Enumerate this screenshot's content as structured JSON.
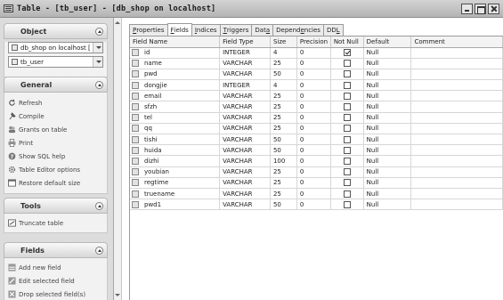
{
  "window": {
    "title": "Table - [tb_user] - [db_shop on localhost]"
  },
  "sidebar": {
    "object_panel": {
      "header": "Object",
      "database_combo": "db_shop on localhost [",
      "table_combo": "tb_user"
    },
    "general_panel": {
      "header": "General",
      "items": [
        {
          "label": "Refresh",
          "icon": "refresh-icon"
        },
        {
          "label": "Compile",
          "icon": "compile-icon"
        },
        {
          "label": "Grants on table",
          "icon": "grants-icon"
        },
        {
          "label": "Print",
          "icon": "print-icon"
        },
        {
          "label": "Show SQL help",
          "icon": "help-icon"
        },
        {
          "label": "Table Editor options",
          "icon": "options-icon"
        },
        {
          "label": "Restore default size",
          "icon": "restore-size-icon"
        }
      ]
    },
    "tools_panel": {
      "header": "Tools",
      "items": [
        {
          "label": "Truncate table",
          "icon": "truncate-icon"
        }
      ]
    },
    "fields_panel": {
      "header": "Fields",
      "items": [
        {
          "label": "Add new field",
          "icon": "add-field-icon"
        },
        {
          "label": "Edit selected field",
          "icon": "edit-field-icon"
        },
        {
          "label": "Drop selected field(s)",
          "icon": "drop-field-icon"
        }
      ]
    }
  },
  "tabs": [
    {
      "pre": "",
      "u": "P",
      "post": "roperties",
      "active": false
    },
    {
      "pre": "",
      "u": "F",
      "post": "ields",
      "active": true
    },
    {
      "pre": "",
      "u": "I",
      "post": "ndices",
      "active": false
    },
    {
      "pre": "",
      "u": "T",
      "post": "riggers",
      "active": false
    },
    {
      "pre": "Dat",
      "u": "a",
      "post": "",
      "active": false
    },
    {
      "pre": "Depend",
      "u": "e",
      "post": "ncies",
      "active": false
    },
    {
      "pre": "DD",
      "u": "L",
      "post": "",
      "active": false
    }
  ],
  "fields_table": {
    "columns": [
      "Field Name",
      "Field Type",
      "Size",
      "Precision",
      "Not Null",
      "Default",
      "Comment"
    ],
    "rows": [
      {
        "name": "id",
        "type": "INTEGER",
        "size": "4",
        "precision": "0",
        "not_null": true,
        "default": "Null",
        "comment": ""
      },
      {
        "name": "name",
        "type": "VARCHAR",
        "size": "25",
        "precision": "0",
        "not_null": false,
        "default": "Null",
        "comment": ""
      },
      {
        "name": "pwd",
        "type": "VARCHAR",
        "size": "50",
        "precision": "0",
        "not_null": false,
        "default": "Null",
        "comment": ""
      },
      {
        "name": "dongjie",
        "type": "INTEGER",
        "size": "4",
        "precision": "0",
        "not_null": false,
        "default": "Null",
        "comment": ""
      },
      {
        "name": "email",
        "type": "VARCHAR",
        "size": "25",
        "precision": "0",
        "not_null": false,
        "default": "Null",
        "comment": ""
      },
      {
        "name": "sfzh",
        "type": "VARCHAR",
        "size": "25",
        "precision": "0",
        "not_null": false,
        "default": "Null",
        "comment": ""
      },
      {
        "name": "tel",
        "type": "VARCHAR",
        "size": "25",
        "precision": "0",
        "not_null": false,
        "default": "Null",
        "comment": ""
      },
      {
        "name": "qq",
        "type": "VARCHAR",
        "size": "25",
        "precision": "0",
        "not_null": false,
        "default": "Null",
        "comment": ""
      },
      {
        "name": "tishi",
        "type": "VARCHAR",
        "size": "50",
        "precision": "0",
        "not_null": false,
        "default": "Null",
        "comment": ""
      },
      {
        "name": "huida",
        "type": "VARCHAR",
        "size": "50",
        "precision": "0",
        "not_null": false,
        "default": "Null",
        "comment": ""
      },
      {
        "name": "dizhi",
        "type": "VARCHAR",
        "size": "100",
        "precision": "0",
        "not_null": false,
        "default": "Null",
        "comment": ""
      },
      {
        "name": "youbian",
        "type": "VARCHAR",
        "size": "25",
        "precision": "0",
        "not_null": false,
        "default": "Null",
        "comment": ""
      },
      {
        "name": "regtime",
        "type": "VARCHAR",
        "size": "25",
        "precision": "0",
        "not_null": false,
        "default": "Null",
        "comment": ""
      },
      {
        "name": "truename",
        "type": "VARCHAR",
        "size": "25",
        "precision": "0",
        "not_null": false,
        "default": "Null",
        "comment": ""
      },
      {
        "name": "pwd1",
        "type": "VARCHAR",
        "size": "50",
        "precision": "0",
        "not_null": false,
        "default": "Null",
        "comment": ""
      }
    ]
  }
}
